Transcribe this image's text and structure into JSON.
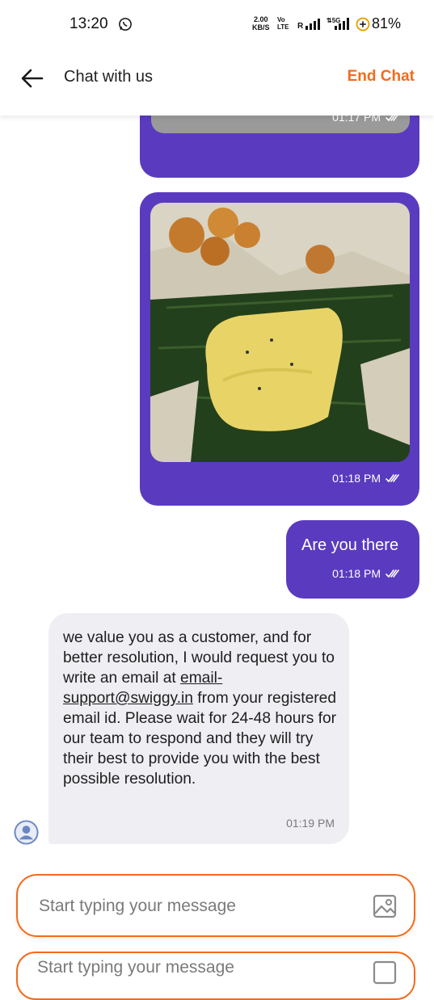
{
  "status_bar": {
    "time": "13:20",
    "net_speed": "2.00",
    "net_unit": "KB/S",
    "volte_top": "Vo",
    "volte_bottom": "LTE",
    "sig_label": "R",
    "net_type": "5G",
    "battery": "81%"
  },
  "header": {
    "title": "Chat with us",
    "end_chat": "End Chat"
  },
  "messages": [
    {
      "direction": "outgoing",
      "type": "image",
      "time": "01:17 PM"
    },
    {
      "direction": "outgoing",
      "type": "image",
      "time": "01:18 PM"
    },
    {
      "direction": "outgoing",
      "type": "text",
      "text": "Are you there",
      "time": "01:18 PM"
    },
    {
      "direction": "incoming",
      "type": "text",
      "text_before": "we value you as a customer, and for better resolution, I would request you to write an email at ",
      "link": "email-support@swiggy.in",
      "text_after": " from your registered email id. Please wait for 24-48 hours for our team to respond and they will try their best to provide you with the best possible resolution.",
      "time": "01:19 PM"
    }
  ],
  "composer": {
    "placeholder": "Start typing your message"
  },
  "colors": {
    "outgoing_bubble": "#5a3bbf",
    "incoming_bubble": "#efeef3",
    "accent": "#f26b1d"
  },
  "icons": [
    "whatsapp-icon",
    "back-arrow-icon",
    "double-check-icon",
    "avatar-icon",
    "image-attach-icon"
  ]
}
